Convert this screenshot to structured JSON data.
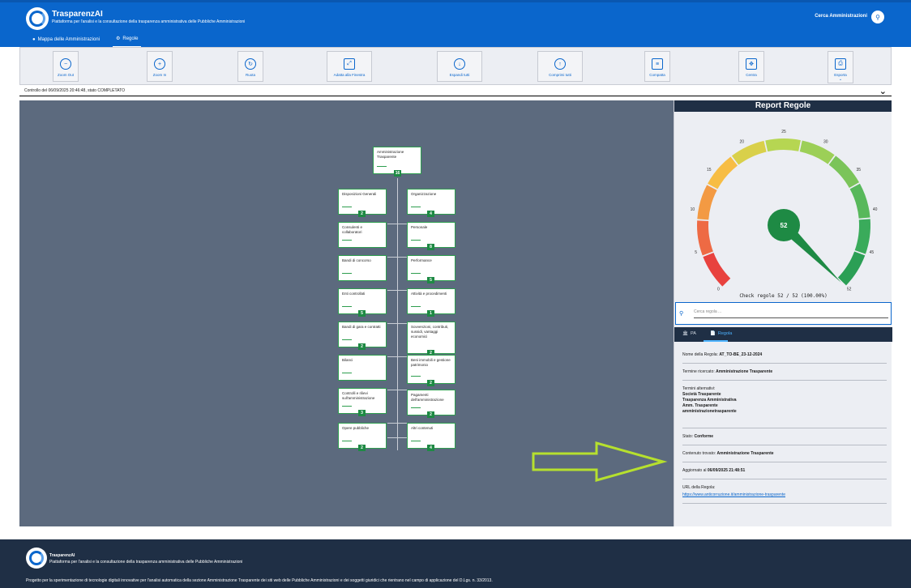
{
  "header": {
    "title": "TrasparenzAI",
    "subtitle": "Piattaforma per l'analisi e la consultazione della trasparenza amministrativa delle Pubbliche Amministrazioni",
    "search_label": "Cerca Amministrazioni",
    "nav": [
      {
        "label": "Mappa delle Amministrazioni",
        "icon": "map-pin-icon"
      },
      {
        "label": "Regole",
        "icon": "gear-icon"
      }
    ]
  },
  "toolbar": {
    "tools": [
      {
        "label": "Zoom Out",
        "icon": "zoom-out-icon",
        "glyph": "−"
      },
      {
        "label": "Zoom In",
        "icon": "zoom-in-icon",
        "glyph": "+"
      },
      {
        "label": "Ruota",
        "icon": "rotate-icon",
        "glyph": "↻"
      },
      {
        "label": "Adatta alla Finestra",
        "icon": "fit-window-icon",
        "glyph": "⤢"
      },
      {
        "label": "Espandi tutti",
        "icon": "expand-all-icon",
        "glyph": "↓"
      },
      {
        "label": "Comprimi tutti",
        "icon": "collapse-all-icon",
        "glyph": "↑"
      },
      {
        "label": "Compatta",
        "icon": "layers-icon",
        "glyph": "≡"
      },
      {
        "label": "Centra",
        "icon": "center-icon",
        "glyph": "✥"
      },
      {
        "label": "Esporta",
        "icon": "export-icon",
        "glyph": "⎙"
      }
    ]
  },
  "status": {
    "text": "Controllo del 06/09/2025 20:46:48, stato COMPLETATO"
  },
  "tree": {
    "root": {
      "label": "Amministrazione Trasparente",
      "count": "16"
    },
    "left": [
      {
        "label": "Disposizioni Generali",
        "count": "2"
      },
      {
        "label": "Consulenti e collaboratori",
        "count": ""
      },
      {
        "label": "Bandi di concorso",
        "count": ""
      },
      {
        "label": "Enti controllati",
        "count": "5"
      },
      {
        "label": "Bandi di gara e contratti",
        "count": "2"
      },
      {
        "label": "Bilanci",
        "count": ""
      },
      {
        "label": "Controlli e rilievi sull'amministrazione",
        "count": "3"
      },
      {
        "label": "Opere pubbliche",
        "count": "2"
      }
    ],
    "right": [
      {
        "label": "Organizzazione",
        "count": "4"
      },
      {
        "label": "Personale",
        "count": "8"
      },
      {
        "label": "Performance",
        "count": "5"
      },
      {
        "label": "Attività e procedimenti",
        "count": "1"
      },
      {
        "label": "Sovvenzioni, contributi, sussidi, vantaggi economici",
        "count": "2"
      },
      {
        "label": "Beni immobili e gestione patrimonio",
        "count": "2"
      },
      {
        "label": "Pagamenti dell'amministrazione",
        "count": "2"
      },
      {
        "label": "Altri contenuti",
        "count": "4"
      }
    ],
    "node_sub": "conforme"
  },
  "report": {
    "title": "Report Regole",
    "gauge_value": "52",
    "gauge_min": 0,
    "gauge_max": 52,
    "gauge_ticks": [
      "0",
      "5",
      "10",
      "15",
      "20",
      "25",
      "30",
      "35",
      "40",
      "45",
      "52"
    ],
    "check_text": "Check regole 52 / 52 (100.00%)",
    "search_placeholder": "Cerca regola ...",
    "tabs": [
      {
        "label": "PA",
        "icon": "bank-icon"
      },
      {
        "label": "Regola",
        "icon": "document-icon"
      }
    ],
    "fields": {
      "nome_label": "Nome della Regola:",
      "nome_value": "AT_TO-BE_23-12-2024",
      "termine_label": "Termine ricercato:",
      "termine_value": "Amministrazione Trasparente",
      "alt_label": "Termini alternativi:",
      "alt_values": [
        "Società Trasparente",
        "Trasparenza Amministrativa",
        "Amm. Trasparente",
        "amministrazionetrasparente"
      ],
      "stato_label": "Stato:",
      "stato_value": "Conforme",
      "contenuto_label": "Contenuto trovato:",
      "contenuto_value": "Amministrazione Trasparente",
      "aggiornato_label": "Aggiornato al",
      "aggiornato_value": "06/09/2025 21:48:51",
      "url_label": "URL della Regola:",
      "url_value": "https://www.anticorruzione.it/amministrazione-trasparente"
    }
  },
  "footer": {
    "title": "TrasparenzAI",
    "subtitle": "Piattaforma per l'analisi e la consultazione della trasparenza amministrativa delle Pubbliche Amministrazioni",
    "bottom": "Progetto per la sperimentazione di tecnologie digitali innovative per l'analisi automatica della sezione Amministrazione Trasparente dei siti web delle Pubbliche Amministrazioni e dei soggetti giuridici che rientrano nel campo di applicazione del D.Lgs. n. 33/2013."
  },
  "colors": {
    "brand": "#0a66cc",
    "dark": "#1f2f45",
    "node_border": "#2e9e4f",
    "arrow": "#b6e02e"
  }
}
